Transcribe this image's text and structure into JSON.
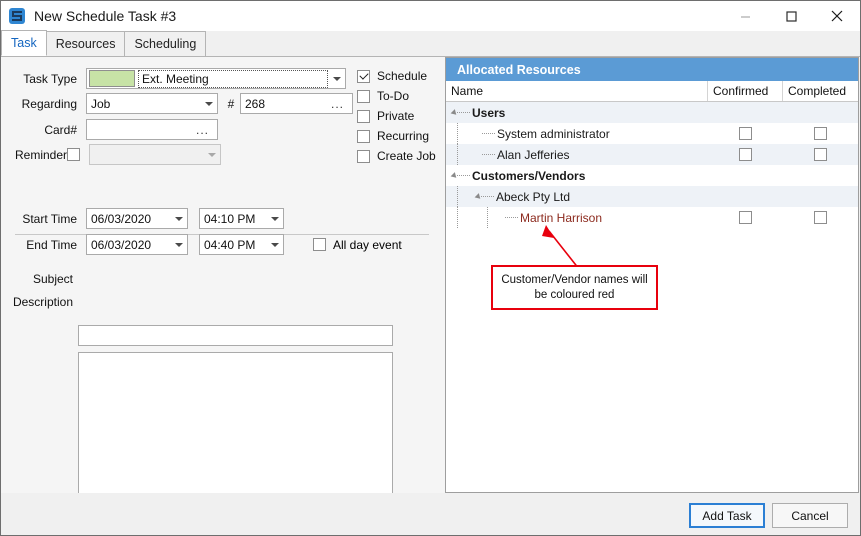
{
  "window": {
    "title": "New Schedule Task #3",
    "icon": "app-icon",
    "controls": {
      "minimize": "minimize-icon",
      "maximize": "maximize-icon",
      "close": "close-icon"
    }
  },
  "tabs": [
    {
      "label": "Task",
      "active": true
    },
    {
      "label": "Resources",
      "active": false
    },
    {
      "label": "Scheduling",
      "active": false
    }
  ],
  "form": {
    "task_type": {
      "label": "Task Type",
      "value": "Ext. Meeting",
      "swatch_color": "#c7e3a6"
    },
    "regarding": {
      "label": "Regarding",
      "value": "Job"
    },
    "number": {
      "label": "#",
      "value": "268",
      "browse": "..."
    },
    "card": {
      "label": "Card#",
      "value": "",
      "browse": "..."
    },
    "reminder": {
      "label": "Reminder",
      "checked": false,
      "value": "",
      "disabled": true
    },
    "start_time": {
      "label": "Start Time",
      "date": "06/03/2020",
      "time": "04:10 PM"
    },
    "end_time": {
      "label": "End Time",
      "date": "06/03/2020",
      "time": "04:40 PM"
    },
    "all_day_event": {
      "label": "All day event",
      "checked": false
    },
    "subject": {
      "label": "Subject",
      "value": ""
    },
    "description": {
      "label": "Description",
      "value": ""
    }
  },
  "options": [
    {
      "label": "Schedule",
      "checked": true
    },
    {
      "label": "To-Do",
      "checked": false
    },
    {
      "label": "Private",
      "checked": false
    },
    {
      "label": "Recurring",
      "checked": false
    },
    {
      "label": "Create Job",
      "checked": false
    }
  ],
  "grid": {
    "caption": "Allocated Resources",
    "columns": [
      "Name",
      "Confirmed",
      "Completed"
    ],
    "rows": [
      {
        "name": "Users",
        "level": 0,
        "type": "group",
        "expander": true,
        "checkboxes": false
      },
      {
        "name": "System administrator",
        "level": 1,
        "type": "item",
        "expander": false,
        "checkboxes": true,
        "confirmed": false,
        "completed": false
      },
      {
        "name": "Alan Jefferies",
        "level": 1,
        "type": "item",
        "expander": false,
        "checkboxes": true,
        "confirmed": false,
        "completed": false
      },
      {
        "name": "Customers/Vendors",
        "level": 0,
        "type": "group",
        "expander": true,
        "checkboxes": false
      },
      {
        "name": "Abeck Pty Ltd",
        "level": 1,
        "type": "subgroup",
        "expander": true,
        "checkboxes": false
      },
      {
        "name": "Martin Harrison",
        "level": 2,
        "type": "red-item",
        "expander": false,
        "checkboxes": true,
        "confirmed": false,
        "completed": false
      }
    ],
    "red_name_color": "#8c2a1e"
  },
  "annotation": {
    "text": "Customer/Vendor names will be coloured red",
    "color": "#e8000d"
  },
  "footer": {
    "add_task": "Add Task",
    "cancel": "Cancel"
  }
}
